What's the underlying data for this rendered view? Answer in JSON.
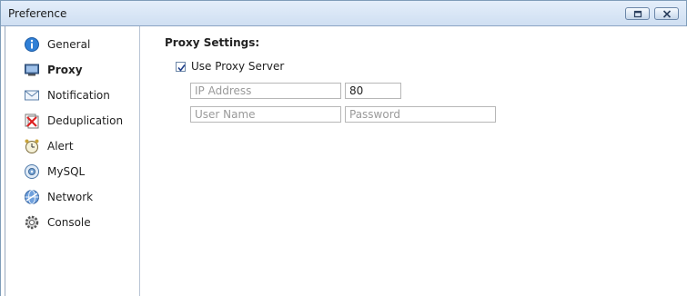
{
  "window": {
    "title": "Preference"
  },
  "sidebar": {
    "items": [
      {
        "label": "General",
        "icon": "info-icon"
      },
      {
        "label": "Proxy",
        "icon": "monitor-icon",
        "active": true
      },
      {
        "label": "Notification",
        "icon": "envelope-icon"
      },
      {
        "label": "Deduplication",
        "icon": "dedup-icon"
      },
      {
        "label": "Alert",
        "icon": "alarm-clock-icon"
      },
      {
        "label": "MySQL",
        "icon": "database-icon"
      },
      {
        "label": "Network",
        "icon": "network-globe-icon"
      },
      {
        "label": "Console",
        "icon": "gear-icon"
      }
    ]
  },
  "proxy": {
    "section_title": "Proxy Settings:",
    "use_proxy_label": "Use Proxy Server",
    "use_proxy_checked": true,
    "ip_placeholder": "IP Address",
    "ip_value": "",
    "port_value": "80",
    "username_placeholder": "User Name",
    "username_value": "",
    "password_placeholder": "Password",
    "password_value": ""
  },
  "colors": {
    "titlebar_top": "#e4eefa",
    "titlebar_bottom": "#cfdff2",
    "border": "#7f9db9"
  }
}
